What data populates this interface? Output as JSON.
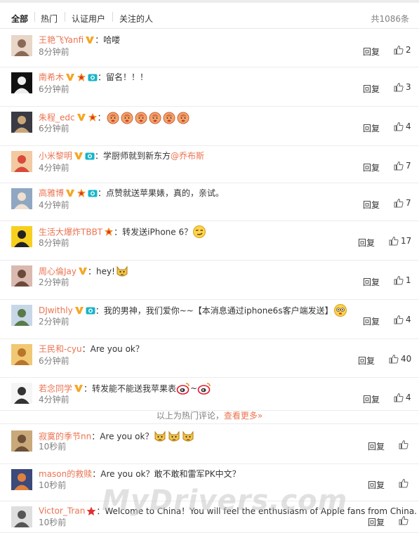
{
  "filters": {
    "tabs": [
      "全部",
      "热门",
      "认证用户",
      "关注的人"
    ],
    "active": 0,
    "total": "共1086条"
  },
  "comments": [
    {
      "user": "王艳飞Yanfi",
      "text": "：哈喽",
      "time": "8分钟前",
      "reply": "回复",
      "likes": "2"
    },
    {
      "user": "南希木",
      "text": "：留名！！！",
      "time": "6分钟前",
      "reply": "回复",
      "likes": "3"
    },
    {
      "user": "朱程_edc",
      "text": "：",
      "time": "6分钟前",
      "reply": "回复",
      "likes": "4"
    },
    {
      "user": "小米黎明",
      "text": "：学厨师就到新东方",
      "mention": "@乔布斯",
      "time": "4分钟前",
      "reply": "回复",
      "likes": "7"
    },
    {
      "user": "高雅博",
      "text": "：点赞就送苹果婊，真的，亲试。",
      "time": "4分钟前",
      "reply": "回复",
      "likes": "7"
    },
    {
      "user": "生活大爆炸TBBT",
      "text": "：转发送iPhone 6？",
      "time": "8分钟前",
      "reply": "回复",
      "likes": "17"
    },
    {
      "user": "周心倫Jay",
      "text": "：hey!",
      "time": "2分钟前",
      "reply": "回复",
      "likes": "1"
    },
    {
      "user": "DJwithly",
      "text": "：我的男神，我们爱你~~【本消息通过iphone6s客户端发送】",
      "time": "2分钟前",
      "reply": "回复",
      "likes": "4"
    },
    {
      "user": "王民和-cyu",
      "text": "：Are you ok？",
      "time": "6分钟前",
      "reply": "回复",
      "likes": "40"
    },
    {
      "user": "若念同学",
      "text": "：转发能不能送我苹果表",
      "time": "4分钟前",
      "reply": "回复",
      "likes": "4",
      "tilde": "~"
    },
    {
      "user": "寂寞的季节nn",
      "text": "：Are you ok？",
      "time": "10秒前",
      "reply": "回复",
      "likes": ""
    },
    {
      "user": "mason的救赎",
      "text": "：Are you ok？敢不敢和雷军PK中文？",
      "time": "10秒前",
      "reply": "回复",
      "likes": ""
    },
    {
      "user": "Victor_Tran",
      "text": "：Welcome to China！You will feel the enthusiasm of Apple fans from China.",
      "time": "10秒前",
      "reply": "回复",
      "likes": ""
    }
  ],
  "hot_footer": {
    "text": "以上为热门评论，",
    "more": "查看更多»"
  },
  "watermark": "MyDrivers.com",
  "colors": {
    "accent": "#eb7350",
    "muted": "#808080",
    "divider": "#ececec",
    "vip": "#f5a623",
    "camera": "#18b4c8"
  }
}
